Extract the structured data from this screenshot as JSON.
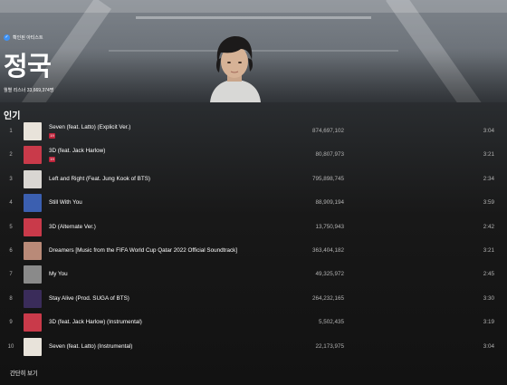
{
  "artist": {
    "verified_label": "확인된 아티스트",
    "name": "정국",
    "monthly_listeners": "월별 리스너 33,669,374명"
  },
  "popular": {
    "heading": "인기",
    "see_less_label": "간단히 보기",
    "tracks": [
      {
        "rank": "1",
        "title": "Seven (feat. Latto) (Explicit Ver.)",
        "explicit": true,
        "plays": "874,697,102",
        "duration": "3:04",
        "thumb_color": "#e8e3da"
      },
      {
        "rank": "2",
        "title": "3D (feat. Jack Harlow)",
        "explicit": true,
        "plays": "80,807,973",
        "duration": "3:21",
        "thumb_color": "#c93a4a"
      },
      {
        "rank": "3",
        "title": "Left and Right (Feat. Jung Kook of BTS)",
        "explicit": false,
        "plays": "795,898,745",
        "duration": "2:34",
        "thumb_color": "#d9d6d2"
      },
      {
        "rank": "4",
        "title": "Still With You",
        "explicit": false,
        "plays": "88,909,194",
        "duration": "3:59",
        "thumb_color": "#3b5fb0"
      },
      {
        "rank": "5",
        "title": "3D (Alternate Ver.)",
        "explicit": false,
        "plays": "13,750,943",
        "duration": "2:42",
        "thumb_color": "#c93a4a"
      },
      {
        "rank": "6",
        "title": "Dreamers [Music from the FIFA World Cup Qatar 2022 Official Soundtrack]",
        "explicit": false,
        "plays": "363,404,182",
        "duration": "3:21",
        "thumb_color": "#b98a78"
      },
      {
        "rank": "7",
        "title": "My You",
        "explicit": false,
        "plays": "49,325,972",
        "duration": "2:45",
        "thumb_color": "#8a8a8a"
      },
      {
        "rank": "8",
        "title": "Stay Alive (Prod. SUGA of BTS)",
        "explicit": false,
        "plays": "264,232,165",
        "duration": "3:30",
        "thumb_color": "#3a2c5a"
      },
      {
        "rank": "9",
        "title": "3D (feat. Jack Harlow) (Instrumental)",
        "explicit": false,
        "plays": "5,502,435",
        "duration": "3:19",
        "thumb_color": "#c93a4a"
      },
      {
        "rank": "10",
        "title": "Seven (feat. Latto) (Instrumental)",
        "explicit": false,
        "plays": "22,173,975",
        "duration": "3:04",
        "thumb_color": "#e8e3da"
      }
    ]
  }
}
